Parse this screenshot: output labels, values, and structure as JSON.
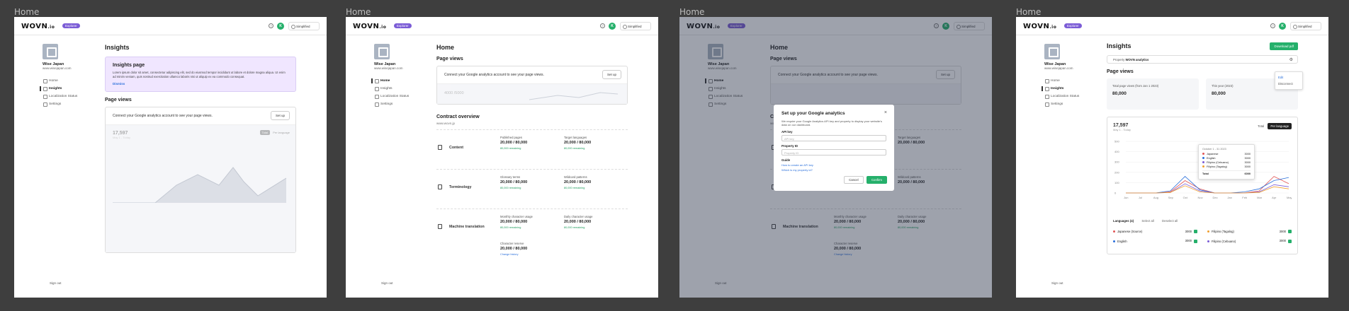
{
  "frames": [
    {
      "label": "Home",
      "page_title": "Insights",
      "promo": {
        "title": "Insights page",
        "text": "Lorem ipsum dolor sit amet, consectetur adipiscing elit, sed do eiusmod tempor incididunt ut labore et dolore magna aliqua. Ut enim ad minim veniam, quis nostrud exercitation ullamco laboris nisi ut aliquip ex ea commodo consequat.",
        "link": "Dismiss"
      },
      "page_views_heading": "Page views",
      "setup_text": "Connect your Google analytics account to see your page views.",
      "setup_button": "Set up",
      "ghost_total": "17,597",
      "ghost_range": "May 1 - Today",
      "ghost_tabs": [
        "Total",
        "Per language"
      ]
    },
    {
      "label": "Home",
      "page_title": "Home",
      "page_views_heading": "Page views",
      "setup_text": "Connect your Google analytics account to see your page views.",
      "setup_button": "Set up",
      "ghost_stat": "4000 /5000",
      "contract_heading": "Contract overview",
      "contract_sub": "www.wovn.jp",
      "rows": [
        {
          "title": "Content",
          "a_label": "Published pages",
          "a_value": "20,000 / 80,000",
          "a_rem": "80,000 remaining",
          "b_label": "Target languages",
          "b_value": "20,000 / 80,000",
          "b_rem": "80,000 remaining"
        },
        {
          "title": "Terminology",
          "a_label": "Glossary terms",
          "a_value": "20,000 / 80,000",
          "a_rem": "80,000 remaining",
          "b_label": "Wildcard patterns",
          "b_value": "20,000 / 80,000",
          "b_rem": "80,000 remaining"
        },
        {
          "title": "Machine translation",
          "a_label": "Monthly character usage",
          "a_value": "20,000 / 80,000",
          "a_rem": "80,000 remaining",
          "b_label": "Daily character usage",
          "b_value": "20,000 / 80,000",
          "b_rem": "80,000 remaining"
        }
      ],
      "extra": {
        "label": "Character reserve",
        "value": "20,000 / 80,000",
        "link": "Change history"
      }
    },
    {
      "label": "Home",
      "modal": {
        "title": "Set up your Google analytics",
        "text": "We require your Google Analytics API key and property to display your website's data on our dashboard.",
        "api_label": "API key",
        "api_placeholder": "API key",
        "prop_label": "Property ID",
        "prop_placeholder": "Property ID",
        "guide_label": "Guide",
        "guide_link1": "How to create an API key",
        "guide_link2": "Which is my property id?",
        "cancel": "Cancel",
        "confirm": "Confirm"
      }
    },
    {
      "label": "Home",
      "page_title": "Insights",
      "download": "Download pdf",
      "property_label": "Property",
      "property_value": "WOVN analytics",
      "menu": [
        "Edit",
        "Disconnect"
      ],
      "page_views_heading": "Page views",
      "stat1_label": "Total page views (from Jan 1 2023)",
      "stat1_value": "80,000",
      "stat2_label": "This year (2023)",
      "stat2_value": "80,000",
      "chart_total": "17,597",
      "chart_range": "May 1 - Today",
      "seg": [
        "Total",
        "Per language"
      ],
      "tooltip": {
        "title": "October 1 - 31 2023",
        "rows": [
          {
            "name": "Japanese",
            "value": "3000",
            "color": "#e25656"
          },
          {
            "name": "English",
            "value": "3000",
            "color": "#2a6fdb"
          },
          {
            "name": "Filipino (Cebuano)",
            "value": "3000",
            "color": "#7b5cd6"
          },
          {
            "name": "Filipino (Tagalog)",
            "value": "3000",
            "color": "#f0a030"
          }
        ],
        "total_label": "Total",
        "total_value": "6000"
      },
      "lang_tabs": [
        "Languages (4)",
        "Select all",
        "Deselect all"
      ],
      "langs": [
        {
          "name": "Japanese (Source)",
          "value": "3000",
          "color": "#e25656"
        },
        {
          "name": "English",
          "value": "3000",
          "color": "#2a6fdb"
        },
        {
          "name": "Filipino (Tagalog)",
          "value": "3000",
          "color": "#f0a030"
        },
        {
          "name": "Filipino (Cebuano)",
          "value": "3000",
          "color": "#7b5cd6"
        }
      ]
    }
  ],
  "common": {
    "logo": "WOVN",
    "logo_suffix": ".io",
    "plan": "Explorer",
    "avatar": "K",
    "mode": "Simplified",
    "site_name": "Wise Japan",
    "site_url": "www.wisejapan.com",
    "nav": [
      "Home",
      "Insights",
      "Localization Status",
      "Settings"
    ],
    "signout": "Sign out"
  },
  "chart_data": {
    "type": "line",
    "x": [
      "Jun",
      "Jul",
      "Aug",
      "Sep",
      "Oct",
      "Nov",
      "Dec",
      "Jan",
      "Feb",
      "Mar",
      "Apr",
      "May"
    ],
    "y_ticks": [
      "500",
      "400",
      "300",
      "200",
      "100",
      "0"
    ],
    "series": [
      {
        "name": "Japanese",
        "values": [
          0,
          0,
          0,
          10,
          120,
          40,
          0,
          0,
          0,
          20,
          160,
          90
        ]
      },
      {
        "name": "English",
        "values": [
          0,
          0,
          0,
          20,
          160,
          30,
          0,
          0,
          10,
          40,
          120,
          150
        ]
      },
      {
        "name": "Filipino (Cebuano)",
        "values": [
          0,
          0,
          0,
          5,
          90,
          20,
          0,
          0,
          0,
          10,
          80,
          60
        ]
      },
      {
        "name": "Filipino (Tagalog)",
        "values": [
          0,
          0,
          0,
          5,
          70,
          10,
          0,
          0,
          0,
          5,
          60,
          40
        ]
      }
    ]
  }
}
